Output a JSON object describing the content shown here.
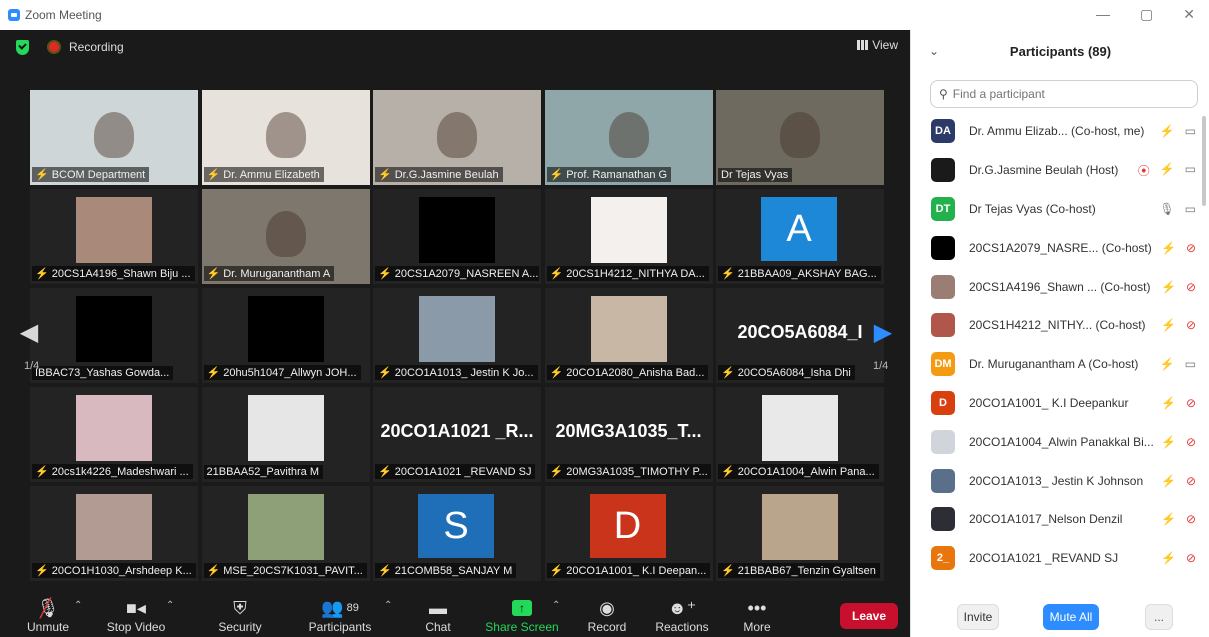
{
  "window": {
    "title": "Zoom Meeting",
    "minimize": "—",
    "restore": "▢",
    "close": "✕"
  },
  "topbar": {
    "recording_label": "Recording",
    "view_label": "View"
  },
  "gallery": {
    "page_left": "1/4",
    "page_right": "1/4",
    "tiles": [
      {
        "label": "BCOM Department",
        "muted": true,
        "bg": "#cfd6d8",
        "big": ""
      },
      {
        "label": "Dr. Ammu Elizabeth",
        "muted": true,
        "bg": "#e8e2dc",
        "big": ""
      },
      {
        "label": "Dr.G.Jasmine Beulah",
        "muted": true,
        "bg": "#b7b0a8",
        "big": ""
      },
      {
        "label": "Prof. Ramanathan G",
        "muted": true,
        "bg": "#8fa7a8",
        "big": ""
      },
      {
        "label": "Dr Tejas Vyas",
        "muted": false,
        "bg": "#6e6a5f",
        "big": "",
        "active": true
      },
      {
        "label": "20CS1A4196_Shawn Biju ...",
        "muted": true,
        "bg": "#a9897a",
        "big": ""
      },
      {
        "label": "Dr. Muruganantham A",
        "muted": true,
        "bg": "#7d776d",
        "big": ""
      },
      {
        "label": "20CS1A2079_NASREEN A...",
        "muted": true,
        "bg": "#000000",
        "big": ""
      },
      {
        "label": "20CS1H4212_NITHYA DA...",
        "muted": true,
        "bg": "#f4f0ee",
        "big": ""
      },
      {
        "label": "21BBAA09_AKSHAY BAG...",
        "muted": true,
        "bg": "#1e88d8",
        "big": "A"
      },
      {
        "label": "IBBAC73_Yashas Gowda...",
        "muted": false,
        "bg": "#000000",
        "big": ""
      },
      {
        "label": "20hu5h1047_Allwyn JOH...",
        "muted": true,
        "bg": "#000000",
        "big": ""
      },
      {
        "label": "20CO1A1013_ Jestin K Jo...",
        "muted": true,
        "bg": "#8a9aa8",
        "big": ""
      },
      {
        "label": "20CO1A2080_Anisha Bad...",
        "muted": true,
        "bg": "#c9b7a6",
        "big": ""
      },
      {
        "label": "20CO5A6084_Isha Dhi",
        "muted": true,
        "bg": "#232323",
        "big": "20CO5A6084_I"
      },
      {
        "label": "20cs1k4226_Madeshwari ...",
        "muted": true,
        "bg": "#d8b9c0",
        "big": ""
      },
      {
        "label": "21BBAA52_Pavithra M",
        "muted": false,
        "bg": "#e6e6e6",
        "big": ""
      },
      {
        "label": "20CO1A1021 _REVAND SJ",
        "muted": true,
        "bg": "#232323",
        "big": "20CO1A1021 _R..."
      },
      {
        "label": "20MG3A1035_TIMOTHY P...",
        "muted": true,
        "bg": "#232323",
        "big": "20MG3A1035_T..."
      },
      {
        "label": "20CO1A1004_Alwin Pana...",
        "muted": true,
        "bg": "#e9e9e9",
        "big": ""
      },
      {
        "label": "20CO1H1030_Arshdeep K...",
        "muted": true,
        "bg": "#b19b93",
        "big": ""
      },
      {
        "label": "MSE_20CS7K1031_PAVIT...",
        "muted": true,
        "bg": "#8da078",
        "big": ""
      },
      {
        "label": "21COMB58_SANJAY M",
        "muted": true,
        "bg": "#1e6fb8",
        "big": "S"
      },
      {
        "label": "20CO1A1001_ K.I Deepan...",
        "muted": true,
        "bg": "#c9341a",
        "big": "D"
      },
      {
        "label": "21BBAB67_Tenzin Gyaltsen",
        "muted": true,
        "bg": "#b8a58c",
        "big": ""
      }
    ]
  },
  "toolbar": {
    "unmute": "Unmute",
    "stop_video": "Stop Video",
    "security": "Security",
    "participants": "Participants",
    "participants_count": "89",
    "chat": "Chat",
    "share_screen": "Share Screen",
    "record": "Record",
    "reactions": "Reactions",
    "more": "More",
    "leave": "Leave"
  },
  "panel": {
    "title": "Participants (89)",
    "search_placeholder": "Find a participant",
    "invite": "Invite",
    "mute_all": "Mute All",
    "more": "...",
    "participants": [
      {
        "initials": "DA",
        "avatar_color": "#2b3a67",
        "name": "Dr. Ammu Elizab...  (Co-host, me)",
        "mic": "muted",
        "cam": "on",
        "rec": false
      },
      {
        "initials": "",
        "avatar_color": "#1a1a1a",
        "name": "Dr.G.Jasmine Beulah (Host)",
        "mic": "muted",
        "cam": "on",
        "rec": true
      },
      {
        "initials": "DT",
        "avatar_color": "#23b14d",
        "name": "Dr Tejas Vyas (Co-host)",
        "mic": "on",
        "cam": "on",
        "rec": false
      },
      {
        "initials": "",
        "avatar_color": "#000000",
        "name": "20CS1A2079_NASRE...  (Co-host)",
        "mic": "muted",
        "cam": "off",
        "rec": false
      },
      {
        "initials": "",
        "avatar_color": "#9a7d73",
        "name": "20CS1A4196_Shawn ...  (Co-host)",
        "mic": "muted",
        "cam": "off",
        "rec": false
      },
      {
        "initials": "",
        "avatar_color": "#b0564a",
        "name": "20CS1H4212_NITHY...  (Co-host)",
        "mic": "muted",
        "cam": "off",
        "rec": false
      },
      {
        "initials": "DM",
        "avatar_color": "#f39c12",
        "name": "Dr. Muruganantham A (Co-host)",
        "mic": "muted",
        "cam": "on",
        "rec": false
      },
      {
        "initials": "D",
        "avatar_color": "#d9400f",
        "name": "20CO1A1001_ K.I Deepankur",
        "mic": "muted",
        "cam": "off",
        "rec": false
      },
      {
        "initials": "",
        "avatar_color": "#cfd5da",
        "name": "20CO1A1004_Alwin Panakkal Bi...",
        "mic": "muted",
        "cam": "off",
        "rec": false
      },
      {
        "initials": "",
        "avatar_color": "#5a6f8a",
        "name": "20CO1A1013_ Jestin K Johnson",
        "mic": "muted",
        "cam": "off",
        "rec": false
      },
      {
        "initials": "",
        "avatar_color": "#2d2d36",
        "name": "20CO1A1017_Nelson Denzil",
        "mic": "muted",
        "cam": "off",
        "rec": false
      },
      {
        "initials": "2_",
        "avatar_color": "#e8760d",
        "name": "20CO1A1021 _REVAND SJ",
        "mic": "muted",
        "cam": "off",
        "rec": false
      }
    ]
  }
}
